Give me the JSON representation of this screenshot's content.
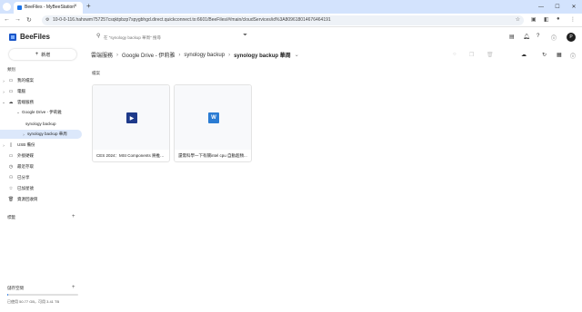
{
  "browser": {
    "tab_title": "BeeFiles - MyBeeStation",
    "url": "10-0-0-116.hahxwm757257csqktpbzp7spygbhgd.direct.quickconnect.to:6601/BeeFiles/#/main/cloudServices/id%3A809618014676464191",
    "new_tab_glyph": "+",
    "close_glyph": "×"
  },
  "app": {
    "name": "BeeFiles",
    "search_placeholder": "在 \"synology backup 華周\" 搜尋",
    "avatar_letter": "P"
  },
  "sidebar": {
    "new_button_label": "新增",
    "section_label": "類別",
    "items": [
      {
        "label": "我的檔案",
        "icon": "folder-icon",
        "caret": "›"
      },
      {
        "label": "電腦",
        "icon": "computer-icon",
        "caret": "›"
      },
      {
        "label": "雲端服務",
        "icon": "cloud-icon",
        "caret": "⌄"
      },
      {
        "label": "Google Drive - 伊莉雅",
        "icon": "",
        "caret": "⌄"
      },
      {
        "label": "synology backup",
        "icon": "",
        "caret": ""
      },
      {
        "label": "synology backup 華周",
        "icon": "",
        "caret": "›"
      },
      {
        "label": "USB 備份",
        "icon": "usb-icon",
        "caret": "›"
      },
      {
        "label": "外接硬碟",
        "icon": "drive-icon",
        "caret": ""
      },
      {
        "label": "最近存取",
        "icon": "clock-icon",
        "caret": ""
      },
      {
        "label": "已分享",
        "icon": "share-icon",
        "caret": ""
      },
      {
        "label": "已加星號",
        "icon": "star-icon",
        "caret": ""
      },
      {
        "label": "資源回收筒",
        "icon": "trash-icon",
        "caret": ""
      }
    ],
    "tags_label": "標籤",
    "storage_label": "儲存空間",
    "storage_text": "已使用 50.77 GB，可用 3.41 TB",
    "storage_used_fraction": 0.015
  },
  "breadcrumb": [
    "雲端服務",
    "Google Drive - 伊莉雅",
    "synology backup",
    "synology backup 華周"
  ],
  "main": {
    "files_label": "檔案",
    "files": [
      {
        "name": "CES 2024：MSI Components 將推出...",
        "type": "video",
        "glyph": "▶",
        "color": "#1e3a8a"
      },
      {
        "name": "還需科學一下有關intel cpu 自動超頻...",
        "type": "word",
        "glyph": "W",
        "color": "#2b7cd3"
      }
    ]
  },
  "colors": {
    "accent": "#1a73e8",
    "active_bg": "#dce8fb"
  }
}
